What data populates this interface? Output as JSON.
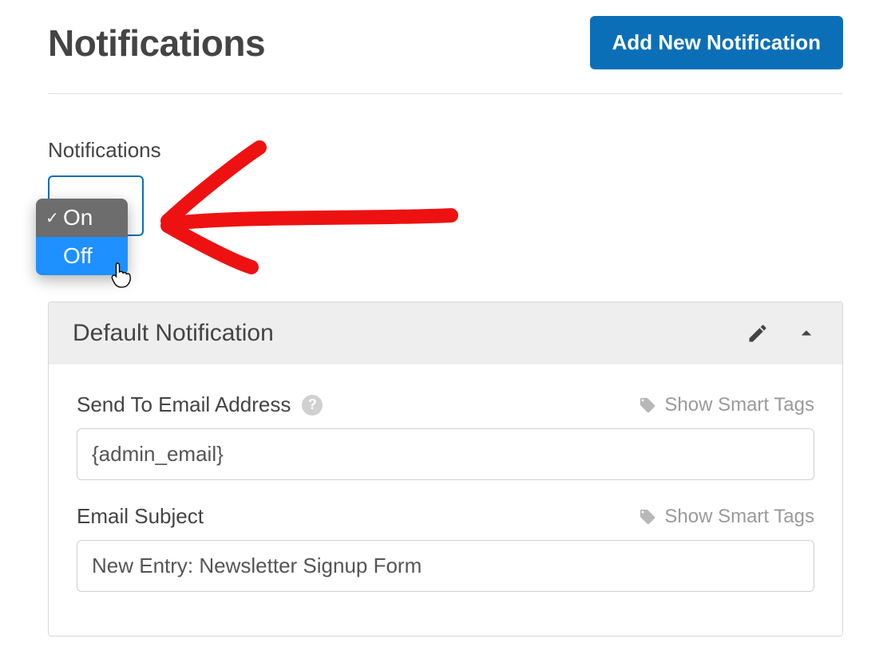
{
  "header": {
    "title": "Notifications",
    "add_button": "Add New Notification"
  },
  "toggle": {
    "label": "Notifications",
    "options": [
      "On",
      "Off"
    ],
    "selected": "On",
    "highlighted": "Off"
  },
  "panel": {
    "title": "Default Notification",
    "fields": {
      "send_to": {
        "label": "Send To Email Address",
        "value": "{admin_email}",
        "smart_tags": "Show Smart Tags"
      },
      "subject": {
        "label": "Email Subject",
        "value": "New Entry: Newsletter Signup Form",
        "smart_tags": "Show Smart Tags"
      }
    }
  },
  "icons": {
    "help": "?",
    "check": "✓"
  }
}
